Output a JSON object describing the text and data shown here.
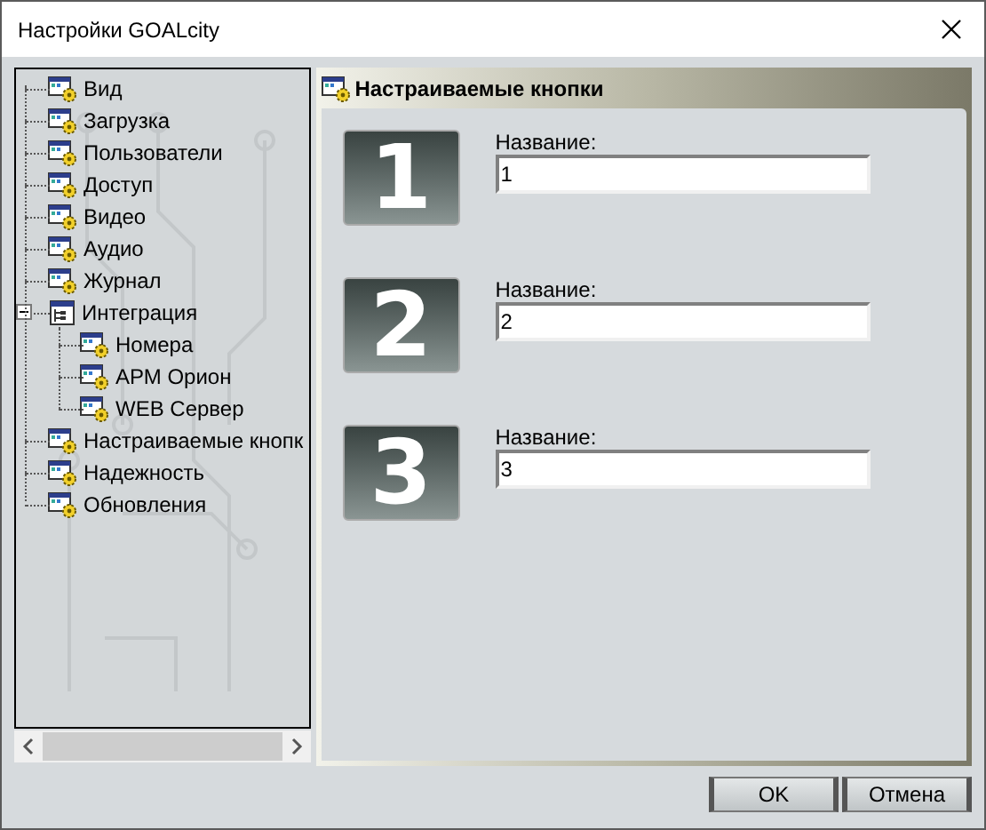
{
  "window": {
    "title": "Настройки GOALcity"
  },
  "tree": [
    {
      "label": "Вид"
    },
    {
      "label": "Загрузка"
    },
    {
      "label": "Пользователи"
    },
    {
      "label": "Доступ"
    },
    {
      "label": "Видео"
    },
    {
      "label": "Аудио"
    },
    {
      "label": "Журнал"
    },
    {
      "label": "Интеграция",
      "kind": "group",
      "expanded": true,
      "children": [
        {
          "label": "Номера"
        },
        {
          "label": "АРМ Орион"
        },
        {
          "label": "WEB Сервер"
        }
      ]
    },
    {
      "label": "Настраиваемые кнопк"
    },
    {
      "label": "Надежность"
    },
    {
      "label": "Обновления"
    }
  ],
  "panel": {
    "title": "Настраиваемые кнопки",
    "buttons": [
      {
        "number": "1",
        "label": "Название:",
        "value": "1"
      },
      {
        "number": "2",
        "label": "Название:",
        "value": "2"
      },
      {
        "number": "3",
        "label": "Название:",
        "value": "3"
      }
    ]
  },
  "buttons": [
    "OK",
    "Отмена"
  ]
}
